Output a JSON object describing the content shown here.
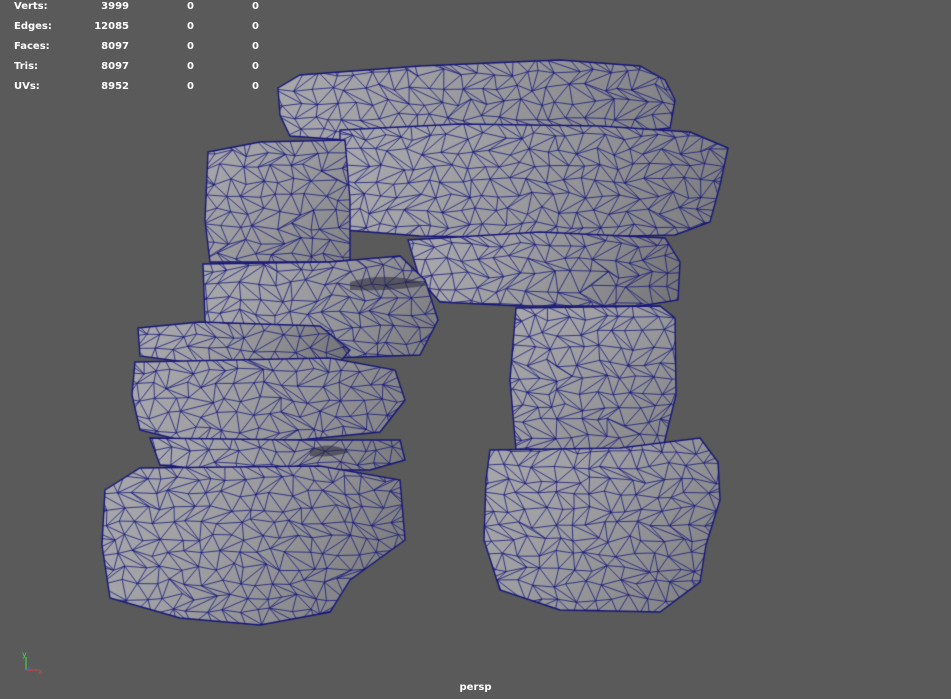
{
  "stats": {
    "rows": [
      {
        "label": "Verts:",
        "values": [
          "3999",
          "0",
          "0"
        ]
      },
      {
        "label": "Edges:",
        "values": [
          "12085",
          "0",
          "0"
        ]
      },
      {
        "label": "Faces:",
        "values": [
          "8097",
          "0",
          "0"
        ]
      },
      {
        "label": "Tris:",
        "values": [
          "8097",
          "0",
          "0"
        ]
      },
      {
        "label": "UVs:",
        "values": [
          "8952",
          "0",
          "0"
        ]
      }
    ]
  },
  "viewport": {
    "camera_label": "persp",
    "background_color": "#5a5a5a",
    "mesh_fill_color": "#9e9ea2",
    "wireframe_color": "#16167a"
  },
  "axis_gizmo": {
    "x_label": "x",
    "y_label": "y",
    "x_color": "#e04040",
    "y_color": "#40e040",
    "z_color": "#4060ff"
  }
}
